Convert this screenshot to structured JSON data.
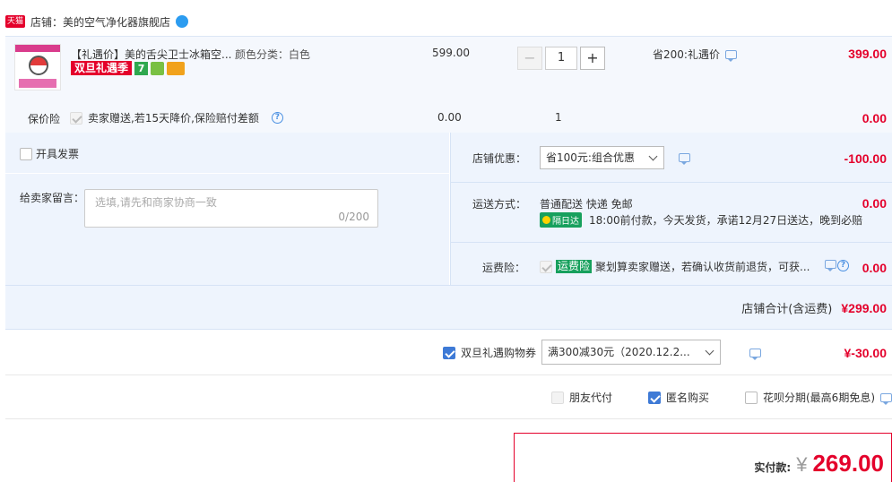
{
  "shop": {
    "badge": "天猫",
    "name": "店铺：美的空气净化器旗舰店"
  },
  "item": {
    "title": "【礼遇价】美的舌尖卫士冰箱空...",
    "spec": "颜色分类：白色",
    "price": "599.00",
    "quantity": "1",
    "promo_label": "双旦礼遇季",
    "discount_text": "省200:礼遇价",
    "subtotal": "399.00",
    "minus": "−",
    "plus": "+"
  },
  "insurance": {
    "label": "保价险",
    "text": "卖家赠送,若15天降价,保险赔付差额",
    "price": "0.00",
    "qty": "1",
    "subtotal": "0.00",
    "help": "?"
  },
  "invoice": {
    "label": "开具发票"
  },
  "message": {
    "label": "给卖家留言：",
    "placeholder": "选填,请先和商家协商一致",
    "counter": "0/200"
  },
  "shop_discount": {
    "label": "店铺优惠：",
    "selected": "省100元:组合优惠",
    "amount": "-100.00"
  },
  "shipping": {
    "label": "运送方式：",
    "method": "普通配送 快递 免邮",
    "badge": "隔日达",
    "note": "18:00前付款，今天发货，承诺12月27日送达，晚到必赔",
    "amount": "0.00"
  },
  "freight_insurance": {
    "label": "运费险：",
    "badge": "运费险",
    "text": "聚划算卖家赠送，若确认收货前退货，可获...",
    "amount": "0.00"
  },
  "shop_total": {
    "label": "店铺合计(含运费)",
    "amount": "¥299.00"
  },
  "coupon": {
    "label": "双旦礼遇购物券",
    "selected": "满300减30元（2020.12.2...",
    "amount": "¥-30.00"
  },
  "options": {
    "friend_pay": "朋友代付",
    "anonymous": "匿名购买",
    "huabei": "花呗分期(最高6期免息)"
  },
  "payment": {
    "label": "实付款:",
    "currency": "¥",
    "amount": "269.00"
  },
  "colors": {
    "accent_red": "#e4002b",
    "panel_blue": "#eef4fd",
    "checkbox_blue": "#3e7ad6",
    "green_badge": "#17a05d"
  }
}
